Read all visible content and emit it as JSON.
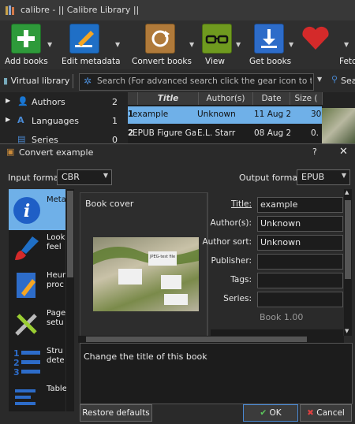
{
  "window": {
    "title": "calibre - || Calibre Library ||",
    "minimize": "–",
    "maximize": "▢",
    "close": "✕"
  },
  "toolbar": [
    {
      "label": "Add books",
      "icon": "add-book-icon",
      "color": "#2e9a3a"
    },
    {
      "label": "Edit metadata",
      "icon": "edit-metadata-icon",
      "color": "#1f6fc6"
    },
    {
      "label": "Convert books",
      "icon": "convert-books-icon",
      "color": "#b07a3a"
    },
    {
      "label": "View",
      "icon": "view-glasses-icon",
      "color": "#6f9a1f"
    },
    {
      "label": "Get books",
      "icon": "get-books-icon",
      "color": "#2d6cc9"
    },
    {
      "label": "Fetc",
      "icon": "heart-icon",
      "color": "#d42a2a"
    }
  ],
  "search": {
    "virtual_library": "Virtual library",
    "placeholder": "Search (For advanced search click the gear icon to the left)",
    "search_label": "Sea"
  },
  "sidebar": [
    {
      "label": "Authors",
      "count": "2"
    },
    {
      "label": "Languages",
      "count": "1"
    },
    {
      "label": "Series",
      "count": "0"
    }
  ],
  "book_list": {
    "columns": [
      "Title",
      "Author(s)",
      "Date",
      "Size ("
    ],
    "rows": [
      {
        "num": "1",
        "title": "example",
        "author": "Unknown",
        "date": "11 Aug 2...",
        "size": "30"
      },
      {
        "num": "2",
        "title": "EPUB Figure Ga...",
        "author": "E.L. Starr",
        "date": "08 Aug 2...",
        "size": "0."
      }
    ]
  },
  "dialog": {
    "title": "Convert example",
    "help": "?",
    "close": "✕",
    "input_format_label": "Input format:",
    "input_format": "CBR",
    "output_format_label": "Output format:",
    "output_format": "EPUB",
    "sections": [
      {
        "label": "Meta",
        "icon": "metadata-info-icon"
      },
      {
        "label": "Look\nfeel",
        "icon": "look-and-feel-brush-icon"
      },
      {
        "label": "Heur\nproc",
        "icon": "heuristic-processing-icon"
      },
      {
        "label": "Page\nsetu",
        "icon": "page-setup-tools-icon"
      },
      {
        "label": "Stru\ndete",
        "icon": "structure-detection-icon"
      },
      {
        "label": "Table",
        "icon": "table-of-contents-icon"
      }
    ],
    "book_cover_label": "Book cover",
    "cover_text_1": "JPEG-test file",
    "fields": [
      {
        "label": "Title:",
        "value": "example"
      },
      {
        "label": "Author(s):",
        "value": "Unknown"
      },
      {
        "label": "Author sort:",
        "value": "Unknown"
      },
      {
        "label": "Publisher:",
        "value": ""
      },
      {
        "label": "Tags:",
        "value": ""
      },
      {
        "label": "Series:",
        "value": ""
      }
    ],
    "series_index": "Book 1.00",
    "description": "Change the title of this book",
    "restore_defaults": "Restore defaults",
    "ok": "OK",
    "cancel": "Cancel"
  }
}
